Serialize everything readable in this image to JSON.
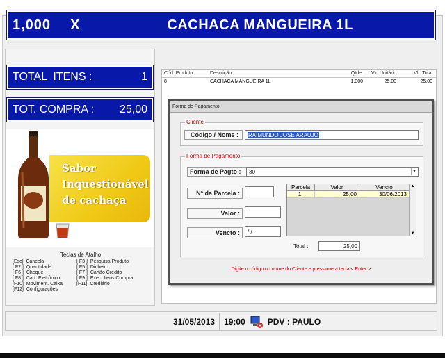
{
  "banner": {
    "quantity": "1,000",
    "times": "X",
    "product_name": "CACHACA MANGUEIRA 1L"
  },
  "totals": {
    "items_label": "TOTAL  ITENS :",
    "items_value": "1",
    "purchase_label": "TOT. COMPRA :",
    "purchase_value": "25,00"
  },
  "promo": {
    "line1": "Sabor",
    "line2": "Inquestionável",
    "line3": "de cachaça"
  },
  "shortcuts": {
    "title": "Teclas de Atalho",
    "items": [
      "[Esc]  Cancela",
      "[ F3 ]  Pesquisa Produto",
      "[ F2 ]  Quantidade",
      "[ F5 ]  Dinheiro",
      "[ F6 ]  Cheque",
      "[ F7 ]  Cartão Crédito",
      "[ F8 ]  Cart. Eletrônico",
      "[ F9 ]  Exec. Itens Compra",
      "[F10]  Moviment. Caixa",
      "[F11]  Crediário",
      "[F12]  Configurações",
      ""
    ]
  },
  "items_table": {
    "headers": [
      "Cód. Produto",
      "Descrição",
      "Qtde.",
      "Vlr. Unitário",
      "Vlr. Total"
    ],
    "rows": [
      [
        "8",
        "CACHACA MANGUEIRA 1L",
        "1,000",
        "25,00",
        "25,00"
      ]
    ]
  },
  "dialog": {
    "title": "Forma de Pagamento",
    "client_group": "Cliente",
    "client_label": "Código / Nome :",
    "client_value": "RAIMUNDO JOSE ARAUJO",
    "payment_group": "Forma de Pagamento",
    "payment_label": "Forma de Pagto :",
    "payment_value": "30",
    "parcel_label": "Nº da Parcela :",
    "parcel_value": "",
    "value_label": "Valor :",
    "value_value": "",
    "due_label": "Vencto :",
    "due_value": "/ /",
    "grid_headers": [
      "Parcela",
      "Valor",
      "Vencto"
    ],
    "grid_rows": [
      [
        "1",
        "25,00",
        "30/06/2013"
      ]
    ],
    "total_label": "Total :",
    "total_value": "25,00",
    "hint": "Digite o código ou nome do Cliente e pressione a tecla < Enter >"
  },
  "status": {
    "date": "31/05/2013",
    "time": "19:00",
    "pdv": "PDV : PAULO"
  },
  "colors": {
    "banner_blue": "#0818a8",
    "hint_red": "#c00000"
  }
}
